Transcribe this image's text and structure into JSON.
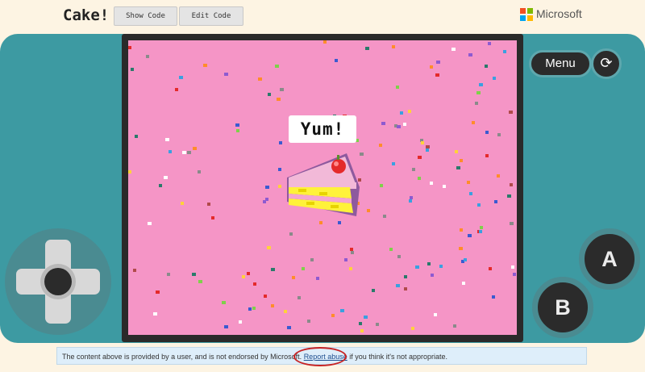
{
  "header": {
    "title": "Cake!",
    "show_code_label": "Show Code",
    "edit_code_label": "Edit Code",
    "brand": "Microsoft",
    "brand_colors": [
      "#f25022",
      "#7fba00",
      "#00a4ef",
      "#ffb900"
    ]
  },
  "game": {
    "speech_text": "Yum!",
    "background_color": "#f595c6"
  },
  "controls": {
    "menu_label": "Menu",
    "refresh_icon": "refresh-icon",
    "refresh_glyph": "⟳",
    "a_label": "A",
    "b_label": "B"
  },
  "notice": {
    "text_before": "The content above is provided by a user, and is not endorsed by Microsoft.",
    "link_label": "Report abuse",
    "text_after": "if you think it's not appropriate."
  }
}
